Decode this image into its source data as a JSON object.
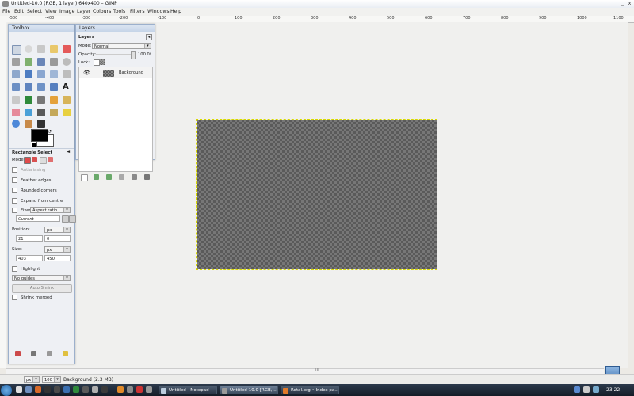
{
  "window": {
    "title": "Untitled-10.0 (RGB, 1 layer) 640x400 – GIMP",
    "controls": [
      "_",
      "□",
      "x"
    ]
  },
  "menu": [
    "File",
    "Edit",
    "Select",
    "View",
    "Image",
    "Layer",
    "Colours",
    "Tools",
    "Filters",
    "Windows",
    "Help"
  ],
  "ruler": {
    "ticks": [
      "-500",
      "-400",
      "-300",
      "-200",
      "-100",
      "0",
      "100",
      "200",
      "300",
      "400",
      "500",
      "600",
      "700",
      "800",
      "900",
      "1000",
      "1100"
    ]
  },
  "toolbox": {
    "title": "Toolbox",
    "tool_options": {
      "title": "Rectangle Select",
      "mode_label": "Mode:",
      "antialiasing": "Antialiasing",
      "feather_edges": "Feather edges",
      "rounded_corners": "Rounded corners",
      "expand_from_centre": "Expand from centre",
      "fixed_label": "Fixed",
      "fixed_value": "Aspect ratio",
      "current_value": "Current",
      "position_label": "Position:",
      "position_unit": "px",
      "position_x": "21",
      "position_y": "0",
      "size_label": "Size:",
      "size_unit": "px",
      "size_w": "403",
      "size_h": "450",
      "highlight": "Highlight",
      "guides_value": "No guides",
      "auto_shrink": "Auto Shrink",
      "shrink_merged": "Shrink merged"
    }
  },
  "layers_dock": {
    "tab": "Layers",
    "panel_title": "Layers",
    "mode_label": "Mode:",
    "mode_value": "Normal",
    "opacity_label": "Opacity:",
    "opacity_value": "100.0",
    "lock_label": "Lock:",
    "layers": [
      {
        "name": "Background"
      }
    ]
  },
  "statusbar": {
    "unit": "px",
    "zoom": "100 %",
    "info": "Background (2.3 MB)"
  },
  "taskbar": {
    "buttons": [
      {
        "label": "Untitled - Notepad",
        "active": false
      },
      {
        "label": "Untitled-10.0 [RGB, ...",
        "active": true
      },
      {
        "label": "Rotal.org • Index pa...",
        "active": false
      }
    ],
    "clock": "23:22"
  }
}
